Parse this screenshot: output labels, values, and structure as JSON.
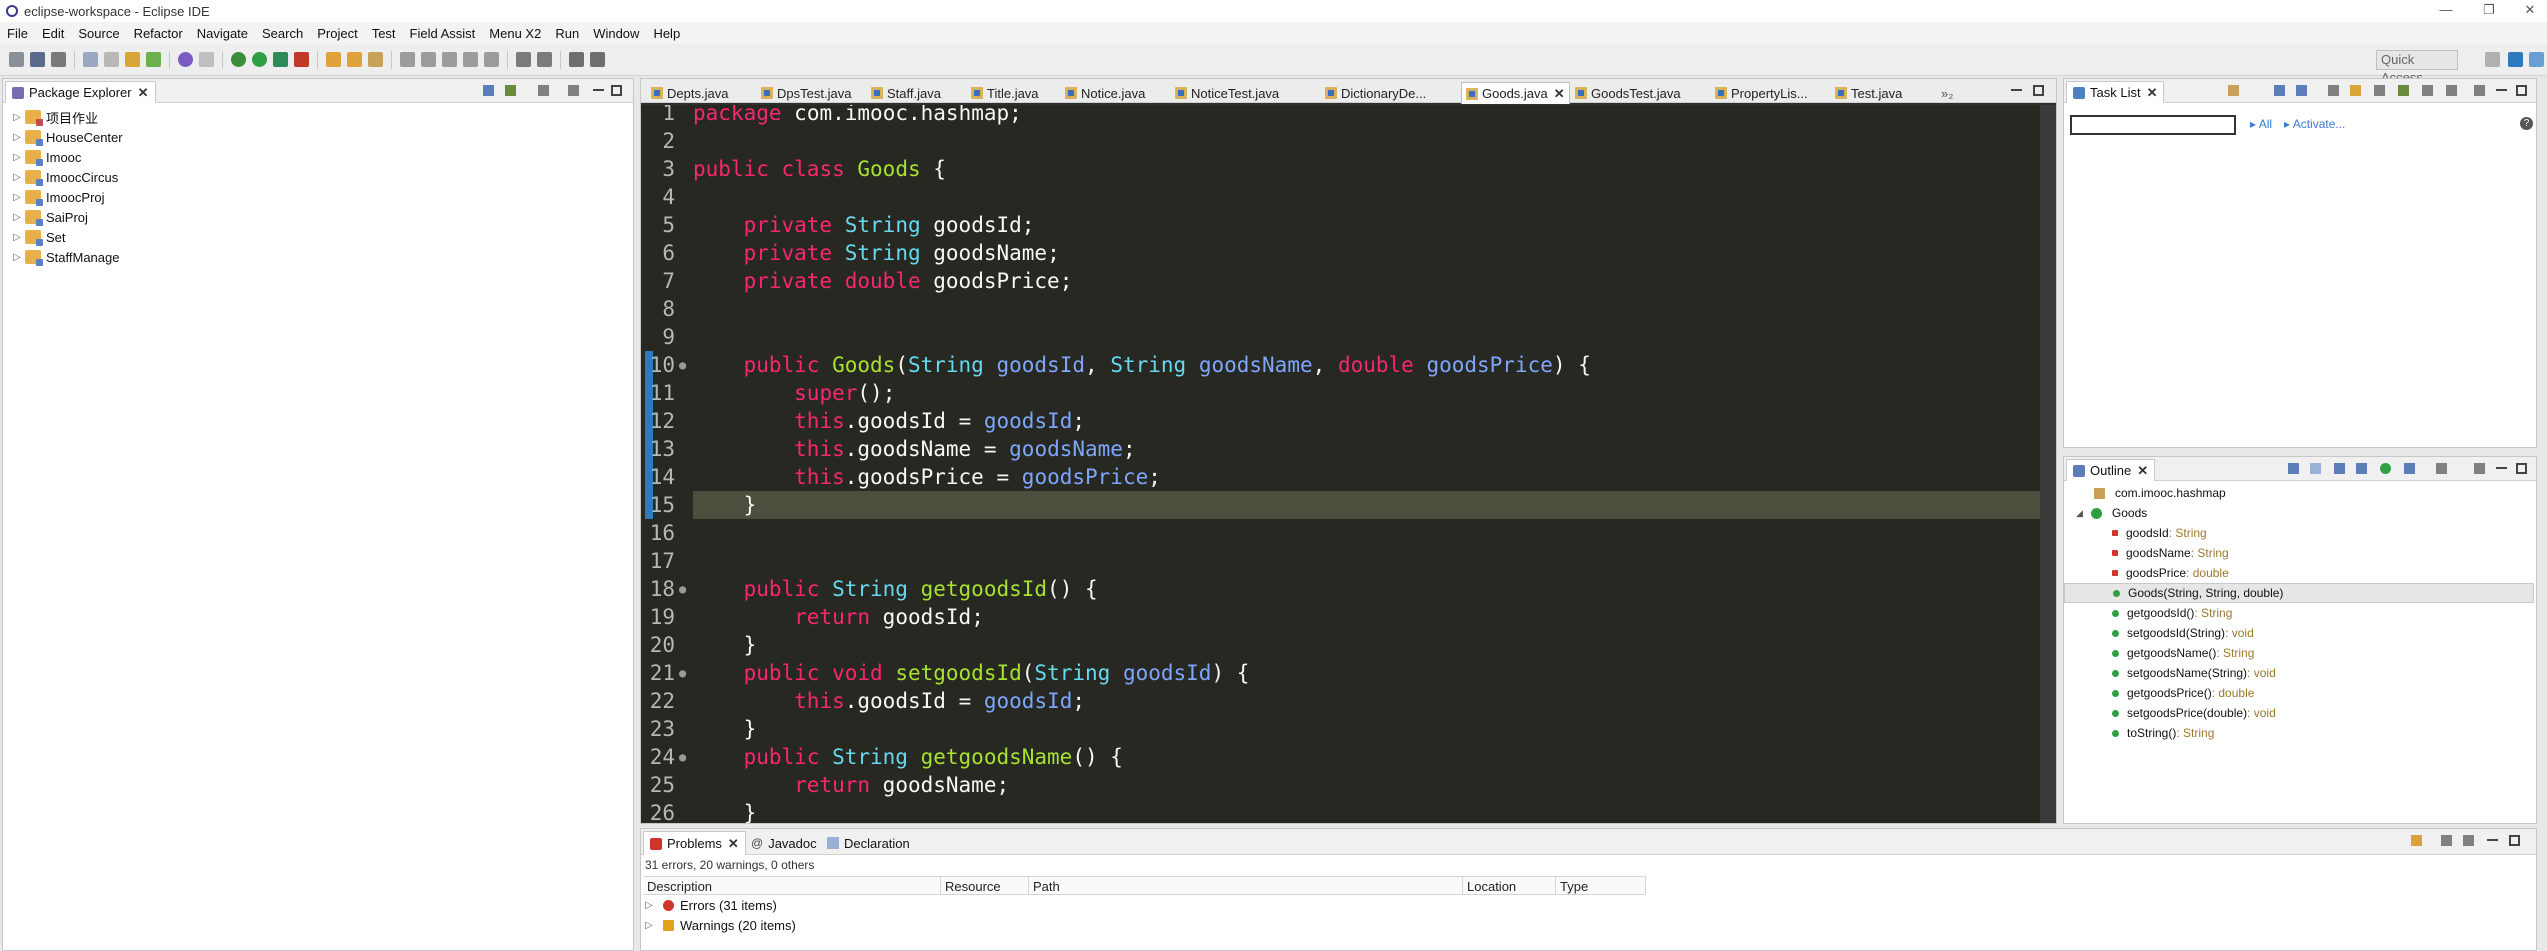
{
  "window": {
    "title": "eclipse-workspace - Eclipse IDE",
    "controls": [
      "—",
      "❐",
      "✕"
    ]
  },
  "menubar": [
    "File",
    "Edit",
    "Source",
    "Refactor",
    "Navigate",
    "Search",
    "Project",
    "Test",
    "Field Assist",
    "Menu X2",
    "Run",
    "Window",
    "Help"
  ],
  "toolbar": {
    "quick_access": "Quick Access"
  },
  "package_explorer": {
    "title": "Package Explorer",
    "projects": [
      "项目作业",
      "HouseCenter",
      "Imooc",
      "ImoocCircus",
      "ImoocProj",
      "SaiProj",
      "Set",
      "StaffManage"
    ]
  },
  "editor": {
    "tabs": [
      "Depts.java",
      "DpsTest.java",
      "Staff.java",
      "Title.java",
      "Notice.java",
      "NoticeTest.java",
      "DictionaryDe...",
      "Goods.java",
      "GoodsTest.java",
      "PropertyLis...",
      "Test.java"
    ],
    "active_tab": "Goods.java",
    "overflow": "»₂",
    "lines": [
      {
        "n": "1",
        "text": "package com.imooc.hashmap;"
      },
      {
        "n": "2",
        "text": ""
      },
      {
        "n": "3",
        "text": "public class Goods {"
      },
      {
        "n": "4",
        "text": ""
      },
      {
        "n": "5",
        "text": "    private String goodsId;"
      },
      {
        "n": "6",
        "text": "    private String goodsName;"
      },
      {
        "n": "7",
        "text": "    private double goodsPrice;"
      },
      {
        "n": "8",
        "text": ""
      },
      {
        "n": "9",
        "text": ""
      },
      {
        "n": "10",
        "text": "    public Goods(String goodsId, String goodsName, double goodsPrice) {"
      },
      {
        "n": "11",
        "text": "        super();"
      },
      {
        "n": "12",
        "text": "        this.goodsId = goodsId;"
      },
      {
        "n": "13",
        "text": "        this.goodsName = goodsName;"
      },
      {
        "n": "14",
        "text": "        this.goodsPrice = goodsPrice;"
      },
      {
        "n": "15",
        "text": "    }"
      },
      {
        "n": "16",
        "text": ""
      },
      {
        "n": "17",
        "text": ""
      },
      {
        "n": "18",
        "text": "    public String getgoodsId() {"
      },
      {
        "n": "19",
        "text": "        return goodsId;"
      },
      {
        "n": "20",
        "text": "    }"
      },
      {
        "n": "21",
        "text": "    public void setgoodsId(String goodsId) {"
      },
      {
        "n": "22",
        "text": "        this.goodsId = goodsId;"
      },
      {
        "n": "23",
        "text": "    }"
      },
      {
        "n": "24",
        "text": "    public String getgoodsName() {"
      },
      {
        "n": "25",
        "text": "        return goodsName;"
      },
      {
        "n": "26",
        "text": "    }"
      }
    ]
  },
  "task_list": {
    "title": "Task List",
    "filter_all": "All",
    "filter_activate": "Activate..."
  },
  "outline": {
    "title": "Outline",
    "package": "com.imooc.hashmap",
    "class": "Goods",
    "members": [
      {
        "name": "goodsId",
        "type": " : String",
        "kind": "field"
      },
      {
        "name": "goodsName",
        "type": " : String",
        "kind": "field"
      },
      {
        "name": "goodsPrice",
        "type": " : double",
        "kind": "field"
      },
      {
        "name": "Goods(String, String, double)",
        "type": "",
        "kind": "ctor"
      },
      {
        "name": "getgoodsId()",
        "type": " : String",
        "kind": "method"
      },
      {
        "name": "setgoodsId(String)",
        "type": " : void",
        "kind": "method"
      },
      {
        "name": "getgoodsName()",
        "type": " : String",
        "kind": "method"
      },
      {
        "name": "setgoodsName(String)",
        "type": " : void",
        "kind": "method"
      },
      {
        "name": "getgoodsPrice()",
        "type": " : double",
        "kind": "method"
      },
      {
        "name": "setgoodsPrice(double)",
        "type": " : void",
        "kind": "method"
      },
      {
        "name": "toString()",
        "type": " : String",
        "kind": "method"
      }
    ]
  },
  "bottom": {
    "tabs": [
      "Problems",
      "Javadoc",
      "Declaration"
    ],
    "summary": "31 errors, 20 warnings, 0 others",
    "columns": [
      "Description",
      "Resource",
      "Path",
      "Location",
      "Type"
    ],
    "rows": [
      "Errors (31 items)",
      "Warnings (20 items)"
    ]
  },
  "colors": {
    "accent": "#2d7bbf",
    "editor_bg": "#272822",
    "error": "#d0342c",
    "warning": "#e3a21a"
  }
}
